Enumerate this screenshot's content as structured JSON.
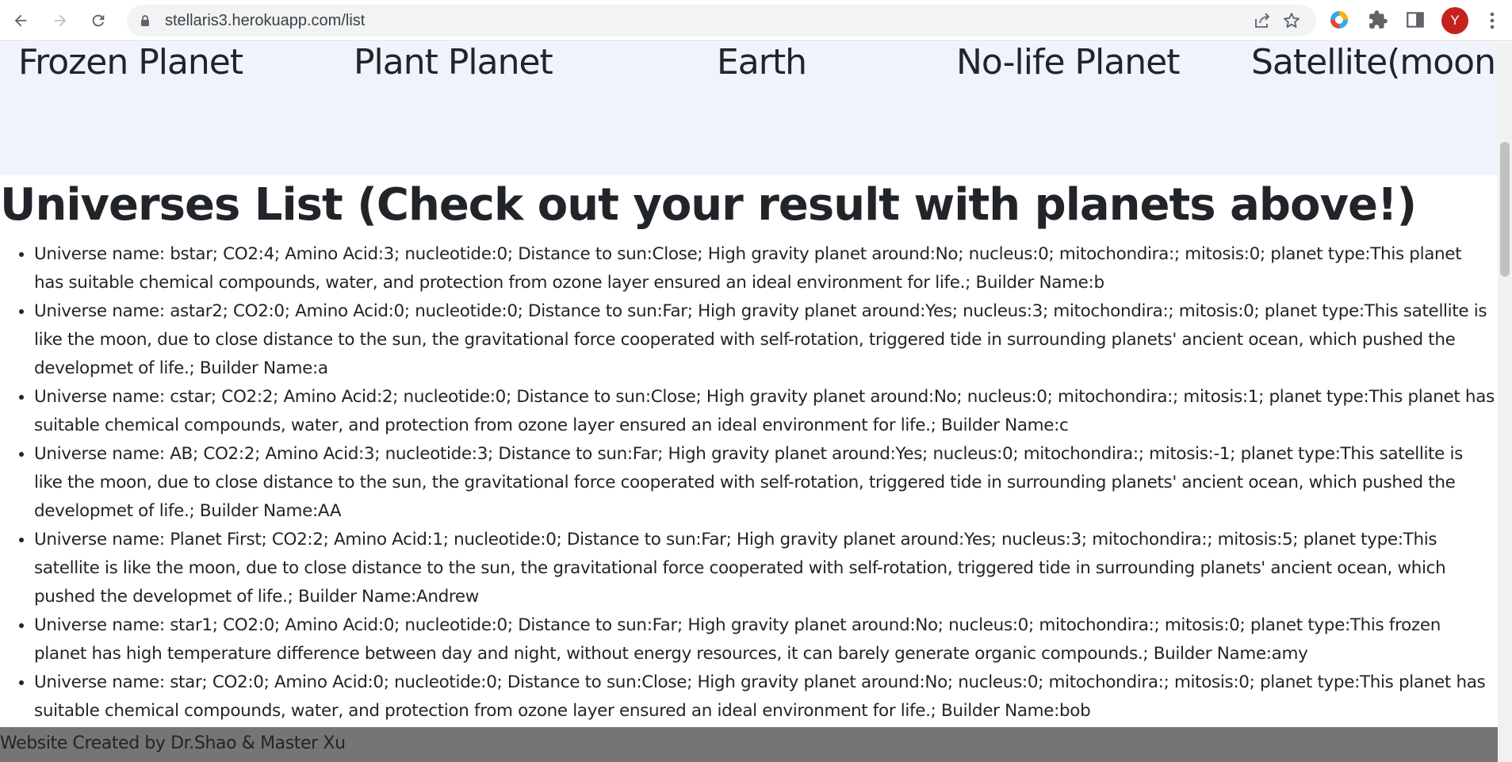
{
  "browser": {
    "url": "stellaris3.herokuapp.com/list",
    "profile_initial": "Y"
  },
  "planets": [
    "Frozen Planet",
    "Plant Planet",
    "Earth",
    "No-life Planet",
    "Satellite(moon)"
  ],
  "page_title": "Universes List (Check out your result with planets above!)",
  "universes": [
    "Universe name: bstar; CO2:4; Amino Acid:3; nucleotide:0; Distance to sun:Close; High gravity planet around:No; nucleus:0; mitochondira:; mitosis:0; planet type:This planet has suitable chemical compounds, water, and protection from ozone layer ensured an ideal environment for life.; Builder Name:b",
    "Universe name: astar2; CO2:0; Amino Acid:0; nucleotide:0; Distance to sun:Far; High gravity planet around:Yes; nucleus:3; mitochondira:; mitosis:0; planet type:This satellite is like the moon, due to close distance to the sun, the gravitational force cooperated with self-rotation, triggered tide in surrounding planets' ancient ocean, which pushed the developmet of life.; Builder Name:a",
    "Universe name: cstar; CO2:2; Amino Acid:2; nucleotide:0; Distance to sun:Close; High gravity planet around:No; nucleus:0; mitochondira:; mitosis:1; planet type:This planet has suitable chemical compounds, water, and protection from ozone layer ensured an ideal environment for life.; Builder Name:c",
    "Universe name: AB; CO2:2; Amino Acid:3; nucleotide:3; Distance to sun:Far; High gravity planet around:Yes; nucleus:0; mitochondira:; mitosis:-1; planet type:This satellite is like the moon, due to close distance to the sun, the gravitational force cooperated with self-rotation, triggered tide in surrounding planets' ancient ocean, which pushed the developmet of life.; Builder Name:AA",
    "Universe name: Planet First; CO2:2; Amino Acid:1; nucleotide:0; Distance to sun:Far; High gravity planet around:Yes; nucleus:3; mitochondira:; mitosis:5; planet type:This satellite is like the moon, due to close distance to the sun, the gravitational force cooperated with self-rotation, triggered tide in surrounding planets' ancient ocean, which pushed the developmet of life.; Builder Name:Andrew",
    "Universe name: star1; CO2:0; Amino Acid:0; nucleotide:0; Distance to sun:Far; High gravity planet around:No; nucleus:0; mitochondira:; mitosis:0; planet type:This frozen planet has high temperature difference between day and night, without energy resources, it can barely generate organic compounds.; Builder Name:amy",
    "Universe name: star; CO2:0; Amino Acid:0; nucleotide:0; Distance to sun:Close; High gravity planet around:No; nucleus:0; mitochondira:; mitosis:0; planet type:This planet has suitable chemical compounds, water, and protection from ozone layer ensured an ideal environment for life.; Builder Name:bob"
  ],
  "footer": "Website Created by Dr.Shao & Master Xu",
  "icons": {
    "back": "back-arrow-icon",
    "forward": "forward-arrow-icon",
    "reload": "reload-icon",
    "lock": "lock-icon",
    "share": "share-icon",
    "bookmark": "bookmark-star-icon",
    "extensions": "puzzle-piece-icon",
    "side_panel": "side-panel-icon",
    "menu": "kebab-menu-icon"
  },
  "colors": {
    "planet_bar_bg": "#eff3fb",
    "footer_bg": "#757575",
    "text": "#212529",
    "avatar": "#c5221f"
  }
}
